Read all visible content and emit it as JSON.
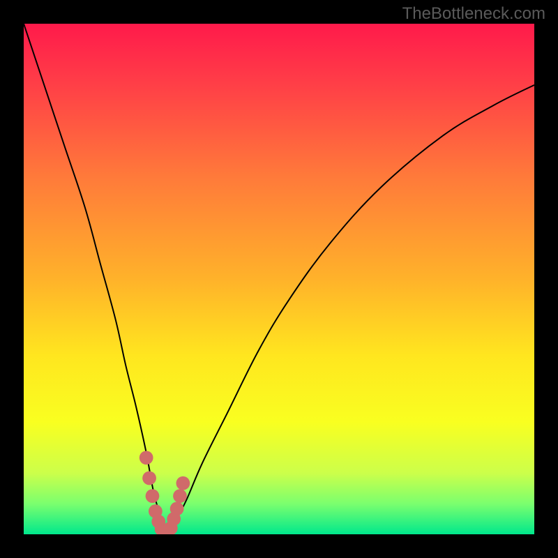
{
  "watermark": "TheBottleneck.com",
  "chart_data": {
    "type": "line",
    "title": "",
    "xlabel": "",
    "ylabel": "",
    "xlim": [
      0,
      100
    ],
    "ylim": [
      0,
      100
    ],
    "background_gradient_stops": [
      {
        "offset": 0.0,
        "color": "#ff1a4b"
      },
      {
        "offset": 0.12,
        "color": "#ff3f47"
      },
      {
        "offset": 0.3,
        "color": "#ff7a3a"
      },
      {
        "offset": 0.5,
        "color": "#ffb22a"
      },
      {
        "offset": 0.65,
        "color": "#ffe61f"
      },
      {
        "offset": 0.78,
        "color": "#f9ff20"
      },
      {
        "offset": 0.88,
        "color": "#ccff4a"
      },
      {
        "offset": 0.94,
        "color": "#7bff6e"
      },
      {
        "offset": 1.0,
        "color": "#00e88c"
      }
    ],
    "series": [
      {
        "name": "bottleneck-curve",
        "x": [
          0,
          4,
          8,
          12,
          15,
          18,
          20,
          22,
          24,
          25.5,
          27,
          28,
          29,
          30,
          32,
          35,
          40,
          46,
          52,
          60,
          70,
          82,
          92,
          100
        ],
        "y": [
          100,
          88,
          76,
          64,
          53,
          42,
          33,
          25,
          16,
          8,
          3,
          0.5,
          0.5,
          3,
          7,
          14,
          24,
          36,
          46,
          57,
          68,
          78,
          84,
          88
        ]
      }
    ],
    "marker_overlay": {
      "name": "valley-highlight",
      "color": "#d06a6a",
      "x": [
        24.0,
        24.6,
        25.2,
        25.8,
        26.4,
        27.0,
        27.6,
        28.2,
        28.8,
        29.4,
        30.0,
        30.6,
        31.2
      ],
      "y": [
        15.0,
        11.0,
        7.5,
        4.5,
        2.5,
        1.0,
        0.4,
        0.4,
        1.2,
        3.0,
        5.0,
        7.5,
        10.0
      ]
    }
  }
}
